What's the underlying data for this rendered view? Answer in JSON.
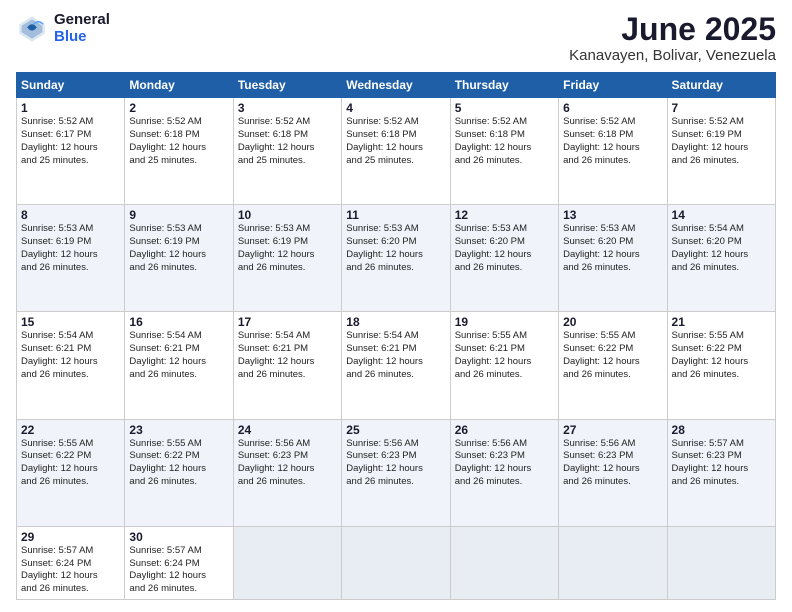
{
  "logo": {
    "general": "General",
    "blue": "Blue"
  },
  "title": "June 2025",
  "location": "Kanavayen, Bolivar, Venezuela",
  "days_header": [
    "Sunday",
    "Monday",
    "Tuesday",
    "Wednesday",
    "Thursday",
    "Friday",
    "Saturday"
  ],
  "weeks": [
    [
      {
        "num": "1",
        "detail": "Sunrise: 5:52 AM\nSunset: 6:17 PM\nDaylight: 12 hours\nand 25 minutes."
      },
      {
        "num": "2",
        "detail": "Sunrise: 5:52 AM\nSunset: 6:18 PM\nDaylight: 12 hours\nand 25 minutes."
      },
      {
        "num": "3",
        "detail": "Sunrise: 5:52 AM\nSunset: 6:18 PM\nDaylight: 12 hours\nand 25 minutes."
      },
      {
        "num": "4",
        "detail": "Sunrise: 5:52 AM\nSunset: 6:18 PM\nDaylight: 12 hours\nand 25 minutes."
      },
      {
        "num": "5",
        "detail": "Sunrise: 5:52 AM\nSunset: 6:18 PM\nDaylight: 12 hours\nand 26 minutes."
      },
      {
        "num": "6",
        "detail": "Sunrise: 5:52 AM\nSunset: 6:18 PM\nDaylight: 12 hours\nand 26 minutes."
      },
      {
        "num": "7",
        "detail": "Sunrise: 5:52 AM\nSunset: 6:19 PM\nDaylight: 12 hours\nand 26 minutes."
      }
    ],
    [
      {
        "num": "8",
        "detail": "Sunrise: 5:53 AM\nSunset: 6:19 PM\nDaylight: 12 hours\nand 26 minutes."
      },
      {
        "num": "9",
        "detail": "Sunrise: 5:53 AM\nSunset: 6:19 PM\nDaylight: 12 hours\nand 26 minutes."
      },
      {
        "num": "10",
        "detail": "Sunrise: 5:53 AM\nSunset: 6:19 PM\nDaylight: 12 hours\nand 26 minutes."
      },
      {
        "num": "11",
        "detail": "Sunrise: 5:53 AM\nSunset: 6:20 PM\nDaylight: 12 hours\nand 26 minutes."
      },
      {
        "num": "12",
        "detail": "Sunrise: 5:53 AM\nSunset: 6:20 PM\nDaylight: 12 hours\nand 26 minutes."
      },
      {
        "num": "13",
        "detail": "Sunrise: 5:53 AM\nSunset: 6:20 PM\nDaylight: 12 hours\nand 26 minutes."
      },
      {
        "num": "14",
        "detail": "Sunrise: 5:54 AM\nSunset: 6:20 PM\nDaylight: 12 hours\nand 26 minutes."
      }
    ],
    [
      {
        "num": "15",
        "detail": "Sunrise: 5:54 AM\nSunset: 6:21 PM\nDaylight: 12 hours\nand 26 minutes."
      },
      {
        "num": "16",
        "detail": "Sunrise: 5:54 AM\nSunset: 6:21 PM\nDaylight: 12 hours\nand 26 minutes."
      },
      {
        "num": "17",
        "detail": "Sunrise: 5:54 AM\nSunset: 6:21 PM\nDaylight: 12 hours\nand 26 minutes."
      },
      {
        "num": "18",
        "detail": "Sunrise: 5:54 AM\nSunset: 6:21 PM\nDaylight: 12 hours\nand 26 minutes."
      },
      {
        "num": "19",
        "detail": "Sunrise: 5:55 AM\nSunset: 6:21 PM\nDaylight: 12 hours\nand 26 minutes."
      },
      {
        "num": "20",
        "detail": "Sunrise: 5:55 AM\nSunset: 6:22 PM\nDaylight: 12 hours\nand 26 minutes."
      },
      {
        "num": "21",
        "detail": "Sunrise: 5:55 AM\nSunset: 6:22 PM\nDaylight: 12 hours\nand 26 minutes."
      }
    ],
    [
      {
        "num": "22",
        "detail": "Sunrise: 5:55 AM\nSunset: 6:22 PM\nDaylight: 12 hours\nand 26 minutes."
      },
      {
        "num": "23",
        "detail": "Sunrise: 5:55 AM\nSunset: 6:22 PM\nDaylight: 12 hours\nand 26 minutes."
      },
      {
        "num": "24",
        "detail": "Sunrise: 5:56 AM\nSunset: 6:23 PM\nDaylight: 12 hours\nand 26 minutes."
      },
      {
        "num": "25",
        "detail": "Sunrise: 5:56 AM\nSunset: 6:23 PM\nDaylight: 12 hours\nand 26 minutes."
      },
      {
        "num": "26",
        "detail": "Sunrise: 5:56 AM\nSunset: 6:23 PM\nDaylight: 12 hours\nand 26 minutes."
      },
      {
        "num": "27",
        "detail": "Sunrise: 5:56 AM\nSunset: 6:23 PM\nDaylight: 12 hours\nand 26 minutes."
      },
      {
        "num": "28",
        "detail": "Sunrise: 5:57 AM\nSunset: 6:23 PM\nDaylight: 12 hours\nand 26 minutes."
      }
    ],
    [
      {
        "num": "29",
        "detail": "Sunrise: 5:57 AM\nSunset: 6:24 PM\nDaylight: 12 hours\nand 26 minutes."
      },
      {
        "num": "30",
        "detail": "Sunrise: 5:57 AM\nSunset: 6:24 PM\nDaylight: 12 hours\nand 26 minutes."
      },
      {
        "num": "",
        "detail": ""
      },
      {
        "num": "",
        "detail": ""
      },
      {
        "num": "",
        "detail": ""
      },
      {
        "num": "",
        "detail": ""
      },
      {
        "num": "",
        "detail": ""
      }
    ]
  ]
}
